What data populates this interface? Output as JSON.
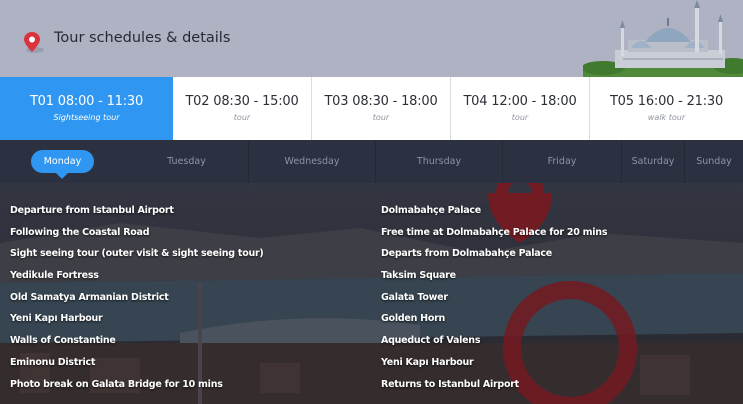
{
  "header": {
    "title": "Tour schedules & details"
  },
  "tours": [
    {
      "code": "T01 08:00 - 11:30",
      "type": "Sightseeing tour",
      "active": true
    },
    {
      "code": "T02 08:30 - 15:00",
      "type": "tour",
      "active": false
    },
    {
      "code": "T03 08:30 - 18:00",
      "type": "tour",
      "active": false
    },
    {
      "code": "T04 12:00 - 18:00",
      "type": "tour",
      "active": false
    },
    {
      "code": "T05 16:00 - 21:30",
      "type": "walk tour",
      "active": false
    }
  ],
  "days": [
    "Monday",
    "Tuesday",
    "Wednesday",
    "Thursday",
    "Friday",
    "Saturday",
    "Sunday"
  ],
  "selected_day": "Monday",
  "itinerary": {
    "left": [
      "Departure from Istanbul Airport",
      "Following the Coastal Road",
      "Sight seeing tour (outer visit & sight seeing tour)",
      "Yedikule Fortress",
      "Old Samatya Armanian District",
      "Yeni Kapı Harbour",
      "Walls of Constantine",
      "Eminonu District",
      "Photo break on Galata Bridge for 10 mins"
    ],
    "right": [
      "Dolmabahçe Palace",
      "Free time at Dolmabahçe Palace for 20 mins",
      "Departs from Dolmabahçe Palace",
      "Taksim Square",
      "Galata Tower",
      "Golden Horn",
      "Aqueduct of Valens",
      "Yeni Kapı Harbour",
      "Returns to Istanbul Airport"
    ]
  },
  "colors": {
    "accent": "#2f97f2",
    "header_bg": "#aeb2c2",
    "pin": "#d9343d"
  },
  "icons": {
    "location": "map-pin-icon"
  }
}
